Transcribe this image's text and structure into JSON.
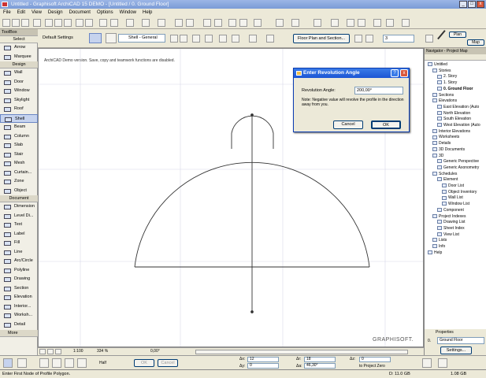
{
  "window": {
    "title": "Untitled - Graphisoft ArchiCAD 15 DEMO - [Untitled / 0. Ground Floor]",
    "min": "_",
    "max": "□",
    "close": "x"
  },
  "menu": [
    "File",
    "Edit",
    "View",
    "Design",
    "Document",
    "Options",
    "Window",
    "Help"
  ],
  "toolbox": {
    "title": "ToolBox",
    "select": "Select",
    "items_top": [
      "Arrow",
      "Marquee"
    ],
    "design_header": "Design",
    "design": [
      "Wall",
      "Door",
      "Window",
      "Skylight",
      "Roof",
      "Shell",
      "Beam",
      "Column",
      "Slab",
      "Stair",
      "Mesh",
      "Curtain...",
      "Zone",
      "Object"
    ],
    "document_header": "Document",
    "document": [
      "Dimension",
      "Level Di...",
      "Text",
      "Label",
      "Fill",
      "Line",
      "Arc/Circle",
      "Polyline",
      "Drawing",
      "Section",
      "Elevation",
      "Interior...",
      "Worksh...",
      "Detail"
    ],
    "more": "More"
  },
  "infobox": {
    "default_settings": "Default Settings",
    "shell_name": "Shell - General",
    "view_button": "Floor Plan and Section...",
    "value1": "3",
    "plan_label": "Plan",
    "map_label": "Map"
  },
  "canvas": {
    "notice": "ArchiCAD Demo version. Save, copy and teamwork functions are disabled.",
    "watermark": "GRAPHISOFT."
  },
  "dialog": {
    "title": "Enter Revolution Angle",
    "label": "Revolution Angle:",
    "value": "200,00°",
    "note": "Note: Negative value will revolve the profile in the direction away from you.",
    "cancel": "Cancel",
    "ok": "OK"
  },
  "navigator": {
    "title": "Navigator - Project Map",
    "tree": [
      {
        "label": "Untitled",
        "d": 0
      },
      {
        "label": "Stories",
        "d": 1
      },
      {
        "label": "2. Story",
        "d": 2
      },
      {
        "label": "1. Story",
        "d": 2
      },
      {
        "label": "0. Ground Floor",
        "d": 2,
        "bold": true
      },
      {
        "label": "Sections",
        "d": 1
      },
      {
        "label": "Elevations",
        "d": 1
      },
      {
        "label": "East Elevation (Auto",
        "d": 2
      },
      {
        "label": "North Elevation",
        "d": 2
      },
      {
        "label": "South Elevation",
        "d": 2
      },
      {
        "label": "West Elevation (Auto",
        "d": 2
      },
      {
        "label": "Interior Elevations",
        "d": 1
      },
      {
        "label": "Worksheets",
        "d": 1
      },
      {
        "label": "Details",
        "d": 1
      },
      {
        "label": "3D Documents",
        "d": 1
      },
      {
        "label": "3D",
        "d": 1
      },
      {
        "label": "Generic Perspective",
        "d": 2
      },
      {
        "label": "Generic Axonometry",
        "d": 2
      },
      {
        "label": "Schedules",
        "d": 1
      },
      {
        "label": "Element",
        "d": 2
      },
      {
        "label": "Door List",
        "d": 3
      },
      {
        "label": "Object Inventory",
        "d": 3
      },
      {
        "label": "Wall List",
        "d": 3
      },
      {
        "label": "Window List",
        "d": 3
      },
      {
        "label": "Component",
        "d": 2
      },
      {
        "label": "Project Indexes",
        "d": 1
      },
      {
        "label": "Drawing List",
        "d": 2
      },
      {
        "label": "Sheet Index",
        "d": 2
      },
      {
        "label": "View List",
        "d": 2
      },
      {
        "label": "Lists",
        "d": 1
      },
      {
        "label": "Info",
        "d": 1
      },
      {
        "label": "Help",
        "d": 0
      }
    ]
  },
  "properties": {
    "title": "Properties",
    "story_num": "0.",
    "story": "Ground Floor",
    "settings": "Settings..."
  },
  "bottombar": {
    "scale": "1:100",
    "zoom": "334 %",
    "angle": "0,00°"
  },
  "infobar2": {
    "half": "Half",
    "ok": "OK",
    "cancel": "Cancel",
    "dx_label": "Δx:",
    "dx": "12",
    "dy_label": "Δy:",
    "dy": "0",
    "dr_label": "Δr:",
    "dr": "18",
    "da_label": "Δa:",
    "da": "46,30°",
    "dz_label": "Δz:",
    "dz": "0",
    "to_proj": "to Project Zero"
  },
  "status": {
    "message": "Enter First Node of Profile Polygon.",
    "disk": "D: 11.0 GB",
    "mem": "1.08 GB"
  }
}
